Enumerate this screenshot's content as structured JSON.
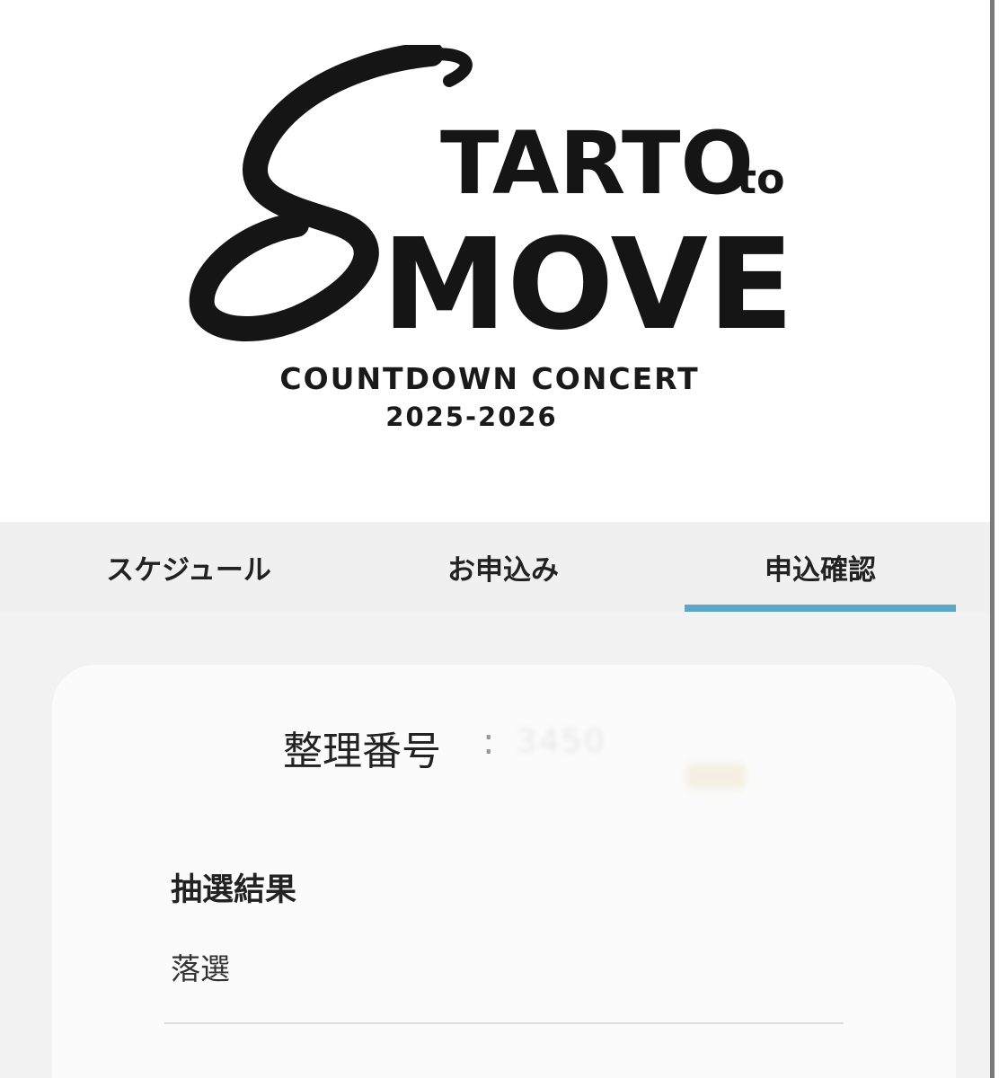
{
  "logo": {
    "start_text": "TARTO",
    "to_text": "to",
    "move_text": "MOVE",
    "initial_letter": "S",
    "subtitle": "COUNTDOWN CONCERT",
    "years": "2025-2026"
  },
  "tabs": [
    {
      "label": "スケジュール",
      "active": false
    },
    {
      "label": "お申込み",
      "active": false
    },
    {
      "label": "申込確認",
      "active": true
    }
  ],
  "accent_color": "#5aa7c6",
  "card": {
    "number_label": "整理番号",
    "number_colon": ":",
    "number_value": "3450",
    "result_heading": "抽選結果",
    "result_value": "落選"
  }
}
